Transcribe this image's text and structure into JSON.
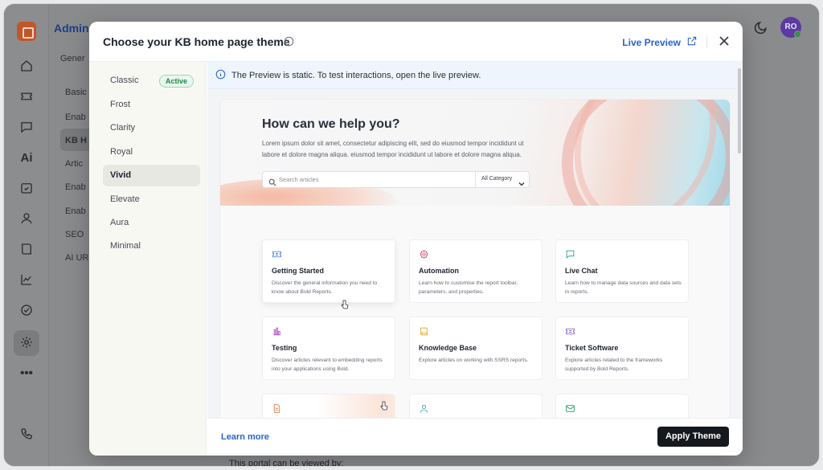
{
  "app": {
    "title": "Admin",
    "tab": "Gener",
    "side_items": [
      "Basic",
      "Enab",
      "KB H",
      "Artic",
      "Enab",
      "Enab",
      "SEO",
      "AI UR"
    ],
    "avatar_initials": "RO",
    "bottom_text": "This portal can be viewed by:"
  },
  "modal": {
    "title": "Choose your KB home page theme",
    "live_preview_label": "Live Preview",
    "themes": [
      {
        "label": "Classic",
        "badge": "Active"
      },
      {
        "label": "Frost"
      },
      {
        "label": "Clarity"
      },
      {
        "label": "Royal"
      },
      {
        "label": "Vivid",
        "selected": true
      },
      {
        "label": "Elevate"
      },
      {
        "label": "Aura"
      },
      {
        "label": "Minimal"
      }
    ],
    "banner_text": "The Preview is static. To test interactions, open the live preview.",
    "learn_more_label": "Learn more",
    "apply_label": "Apply Theme"
  },
  "preview": {
    "hero_title": "How can we help you?",
    "hero_sub": "Lorem ipsum dolor sit amet, consectetur adipiscing elit, sed do eiusmod tempor incididunt ut labore et dolore magna aliqua. eiusmod tempor incididunt ut labore et dolore magna aliqua.",
    "search_placeholder": "Search articles",
    "category_select": "All Category",
    "cards": [
      {
        "icon": "ticket-icon",
        "color": "#3b6fd1",
        "title": "Getting Started",
        "desc": "Discover the general information you need to know about Bold Reports."
      },
      {
        "icon": "gear-icon",
        "color": "#d9486b",
        "title": "Automation",
        "desc": "Learn how to customise the report toolbar, parameters, and properties."
      },
      {
        "icon": "chat-icon",
        "color": "#1aa07a",
        "title": "Live Chat",
        "desc": "Learn how to manage data sources and data sets in reports."
      },
      {
        "icon": "bar-chart-icon",
        "color": "#b14fc4",
        "title": "Testing",
        "desc": "Discover articles relevant to embedding reports into your applications using Bold."
      },
      {
        "icon": "book-icon",
        "color": "#d9a219",
        "title": "Knowledge Base",
        "desc": "Explore articles on working with SSRS reports."
      },
      {
        "icon": "ticket-icon",
        "color": "#7a56c9",
        "title": "Ticket Software",
        "desc": "Explore articles related to the frameworks supported by Bold Reports."
      },
      {
        "icon": "document-icon",
        "color": "#e0733a"
      },
      {
        "icon": "user-icon",
        "color": "#2fa0b8"
      },
      {
        "icon": "mail-icon",
        "color": "#1a9a5a"
      }
    ]
  }
}
